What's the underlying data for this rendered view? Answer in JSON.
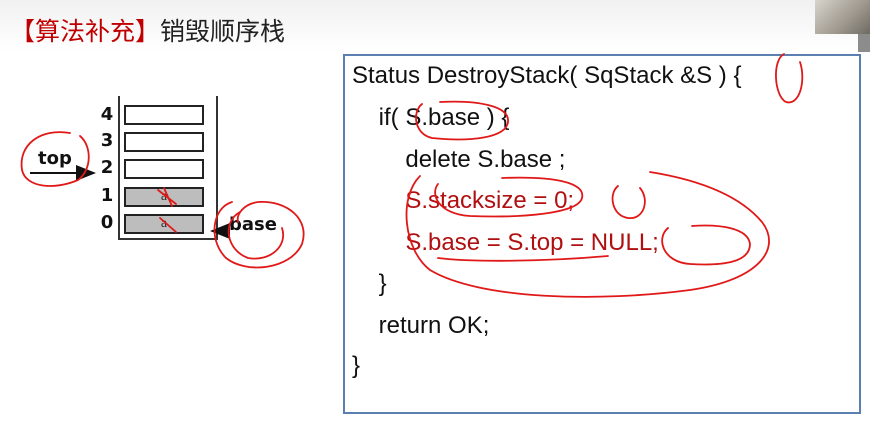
{
  "title": {
    "bracket_open": "【",
    "topic": "算法补充",
    "bracket_close": "】",
    "subtitle": "销毁顺序栈"
  },
  "stack": {
    "indices": [
      "4",
      "3",
      "2",
      "1",
      "0"
    ],
    "cells": [
      {
        "label": "",
        "filled": false
      },
      {
        "label": "",
        "filled": false
      },
      {
        "label": "",
        "filled": false
      },
      {
        "label": "a",
        "filled": true
      },
      {
        "label": "a",
        "filled": true
      }
    ],
    "top_label": "top",
    "base_label": "base"
  },
  "code": {
    "lines": [
      "Status DestroyStack( SqStack &S ) {",
      "    if( S.base ) {",
      "        delete S.base ;",
      "        S.stacksize = 0;",
      "        S.base = S.top = NULL;",
      "    }",
      "    return OK;",
      "}"
    ]
  },
  "colors": {
    "title_red": "#c00000",
    "code_red": "#b01010",
    "ink_red": "#e01818",
    "box_border": "#5b7fb0"
  }
}
